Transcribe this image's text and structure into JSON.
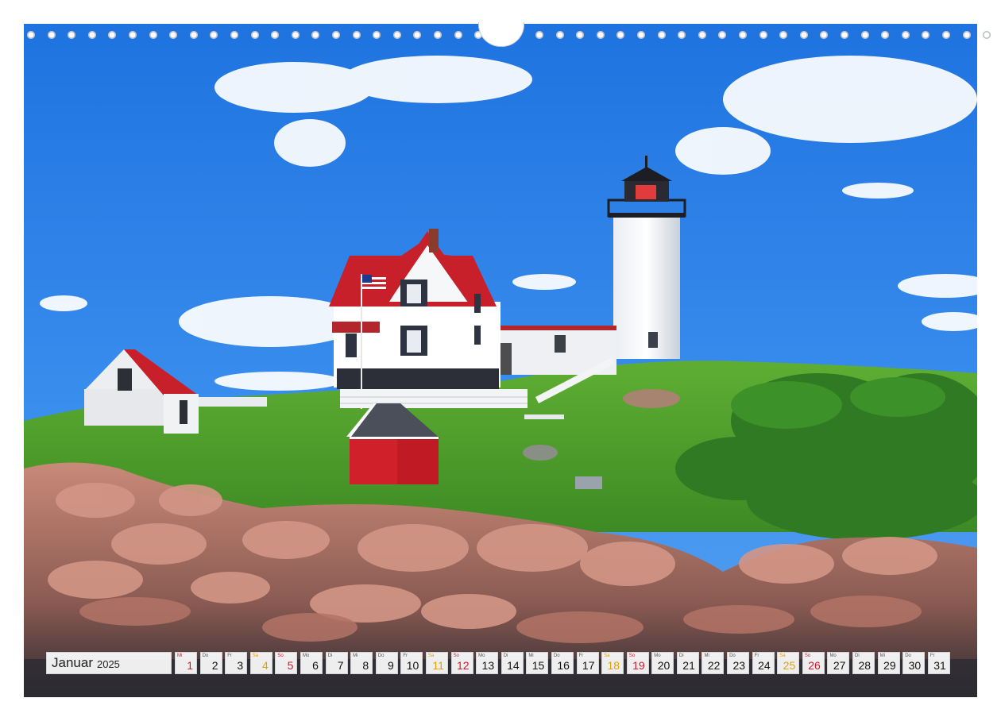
{
  "calendar": {
    "month": "Januar",
    "year": "2025",
    "days": [
      {
        "wd": "Mi",
        "n": "1",
        "kind": "sun"
      },
      {
        "wd": "Do",
        "n": "2",
        "kind": "normal"
      },
      {
        "wd": "Fr",
        "n": "3",
        "kind": "normal"
      },
      {
        "wd": "Sa",
        "n": "4",
        "kind": "sat"
      },
      {
        "wd": "So",
        "n": "5",
        "kind": "sun"
      },
      {
        "wd": "Mo",
        "n": "6",
        "kind": "normal"
      },
      {
        "wd": "Di",
        "n": "7",
        "kind": "normal"
      },
      {
        "wd": "Mi",
        "n": "8",
        "kind": "normal"
      },
      {
        "wd": "Do",
        "n": "9",
        "kind": "normal"
      },
      {
        "wd": "Fr",
        "n": "10",
        "kind": "normal"
      },
      {
        "wd": "Sa",
        "n": "11",
        "kind": "sat"
      },
      {
        "wd": "So",
        "n": "12",
        "kind": "sun"
      },
      {
        "wd": "Mo",
        "n": "13",
        "kind": "normal"
      },
      {
        "wd": "Di",
        "n": "14",
        "kind": "normal"
      },
      {
        "wd": "Mi",
        "n": "15",
        "kind": "normal"
      },
      {
        "wd": "Do",
        "n": "16",
        "kind": "normal"
      },
      {
        "wd": "Fr",
        "n": "17",
        "kind": "normal"
      },
      {
        "wd": "Sa",
        "n": "18",
        "kind": "sat"
      },
      {
        "wd": "So",
        "n": "19",
        "kind": "sun"
      },
      {
        "wd": "Mo",
        "n": "20",
        "kind": "normal"
      },
      {
        "wd": "Di",
        "n": "21",
        "kind": "normal"
      },
      {
        "wd": "Mi",
        "n": "22",
        "kind": "normal"
      },
      {
        "wd": "Do",
        "n": "23",
        "kind": "normal"
      },
      {
        "wd": "Fr",
        "n": "24",
        "kind": "normal"
      },
      {
        "wd": "Sa",
        "n": "25",
        "kind": "sat"
      },
      {
        "wd": "So",
        "n": "26",
        "kind": "sun"
      },
      {
        "wd": "Mo",
        "n": "27",
        "kind": "normal"
      },
      {
        "wd": "Di",
        "n": "28",
        "kind": "normal"
      },
      {
        "wd": "Mi",
        "n": "29",
        "kind": "normal"
      },
      {
        "wd": "Do",
        "n": "30",
        "kind": "normal"
      },
      {
        "wd": "Fr",
        "n": "31",
        "kind": "normal"
      }
    ]
  },
  "colors": {
    "sunday": "#d0182a",
    "saturday": "#e0a100",
    "sky": "#2f86e8",
    "grass": "#4f9a2a",
    "roof": "#c8202a"
  },
  "binding_holes": 46
}
